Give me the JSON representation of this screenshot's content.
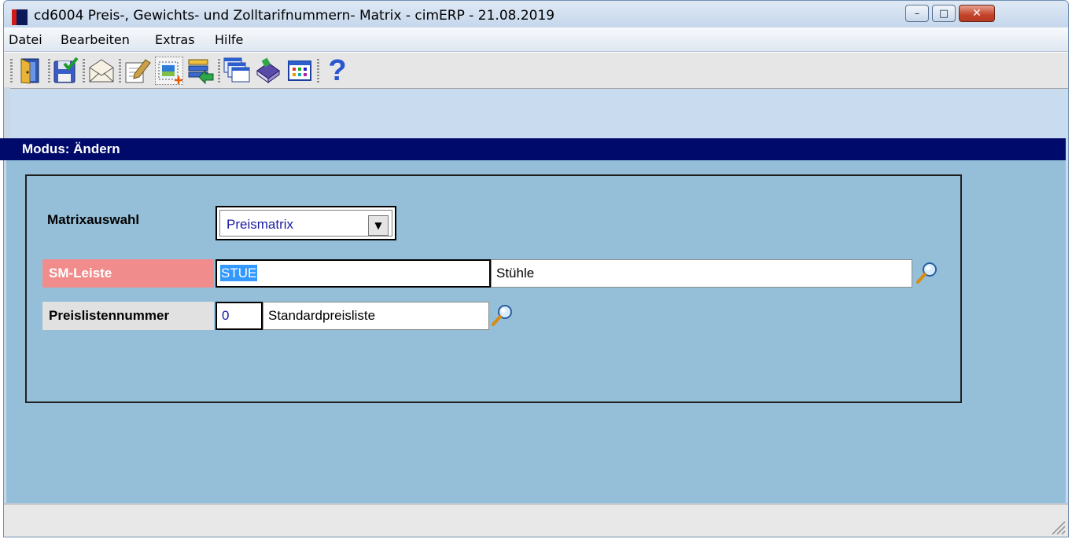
{
  "window": {
    "title": "cd6004 Preis-, Gewichts- und Zolltarifnummern- Matrix - cimERP - 21.08.2019",
    "minimize_label": "–",
    "maximize_label": "□",
    "close_label": "✕"
  },
  "menu": {
    "items": [
      "Datei",
      "Bearbeiten",
      "Extras",
      "Hilfe"
    ]
  },
  "toolbar": {
    "icons": [
      "exit-door-icon",
      "save-check-icon",
      "mail-envelope-icon",
      "edit-notes-icon",
      "new-record-icon",
      "list-import-icon",
      "windows-stack-icon",
      "book-icon",
      "grid-table-icon",
      "help-question-icon"
    ],
    "help_glyph": "?"
  },
  "mode": {
    "text": "Modus: Ändern"
  },
  "form": {
    "matrix_label": "Matrixauswahl",
    "matrix_value": "Preismatrix",
    "matrix_arrow": "▼",
    "sm_label": "SM-Leiste",
    "sm_code": "STUE",
    "sm_name": "Stühle",
    "preis_label": "Preislistennummer",
    "preis_code": "0",
    "preis_name": "Standardpreisliste"
  },
  "colors": {
    "mode_bar": "#000a6b",
    "client_bg": "#95bfd9",
    "sm_label_bg": "#f08c8c",
    "selection": "#3399ff"
  }
}
